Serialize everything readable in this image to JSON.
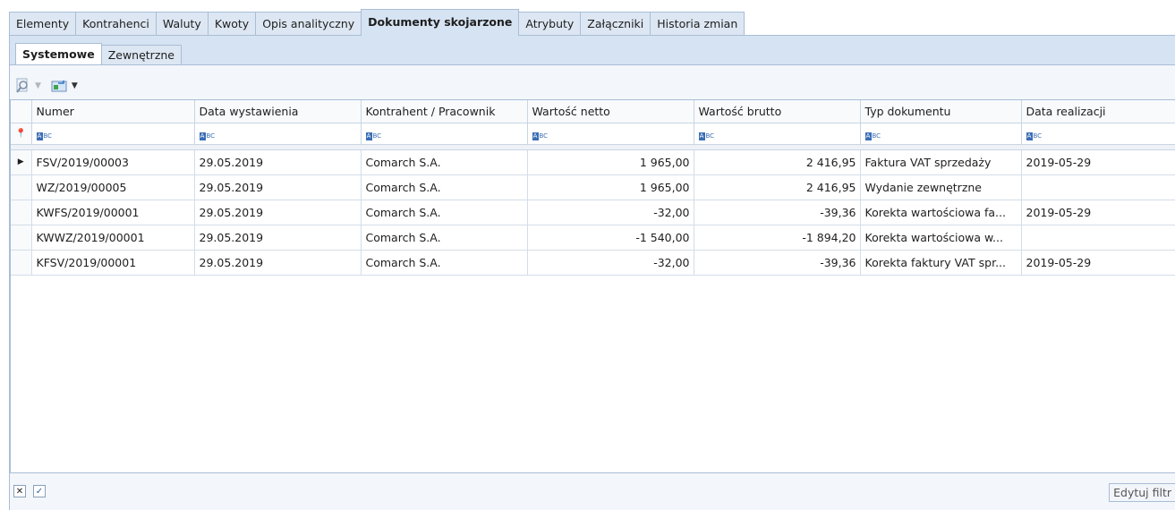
{
  "top_tabs": [
    "Elementy",
    "Kontrahenci",
    "Waluty",
    "Kwoty",
    "Opis analityczny",
    "Dokumenty skojarzone",
    "Atrybuty",
    "Załączniki",
    "Historia zmian"
  ],
  "active_top_tab": "Dokumenty skojarzone",
  "sub_tabs": [
    "Systemowe",
    "Zewnętrzne"
  ],
  "active_sub_tab": "Systemowe",
  "toolbar": {
    "preview_icon": "magnifier-icon",
    "export_icon": "export-icon"
  },
  "grid": {
    "columns": [
      "Numer",
      "Data wystawienia",
      "Kontrahent / Pracownik",
      "Wartość netto",
      "Wartość brutto",
      "Typ dokumentu",
      "Data realizacji"
    ],
    "filter_placeholder": "ABC",
    "rows": [
      {
        "numer": "FSV/2019/00003",
        "data": "29.05.2019",
        "kontrahent": "Comarch S.A.",
        "netto": "1 965,00",
        "brutto": "2 416,95",
        "typ": "Faktura VAT sprzedaży",
        "realizacja": "2019-05-29"
      },
      {
        "numer": "WZ/2019/00005",
        "data": "29.05.2019",
        "kontrahent": "Comarch S.A.",
        "netto": "1 965,00",
        "brutto": "2 416,95",
        "typ": "Wydanie zewnętrzne",
        "realizacja": ""
      },
      {
        "numer": "KWFS/2019/00001",
        "data": "29.05.2019",
        "kontrahent": "Comarch S.A.",
        "netto": "-32,00",
        "brutto": "-39,36",
        "typ": "Korekta wartościowa fa...",
        "realizacja": "2019-05-29"
      },
      {
        "numer": "KWWZ/2019/00001",
        "data": "29.05.2019",
        "kontrahent": "Comarch S.A.",
        "netto": "-1 540,00",
        "brutto": "-1 894,20",
        "typ": "Korekta wartościowa w...",
        "realizacja": ""
      },
      {
        "numer": "KFSV/2019/00001",
        "data": "29.05.2019",
        "kontrahent": "Comarch S.A.",
        "netto": "-32,00",
        "brutto": "-39,36",
        "typ": "Korekta faktury VAT spr...",
        "realizacja": "2019-05-29"
      }
    ]
  },
  "bottom": {
    "edit_filter_label": "Edytuj filtr"
  }
}
